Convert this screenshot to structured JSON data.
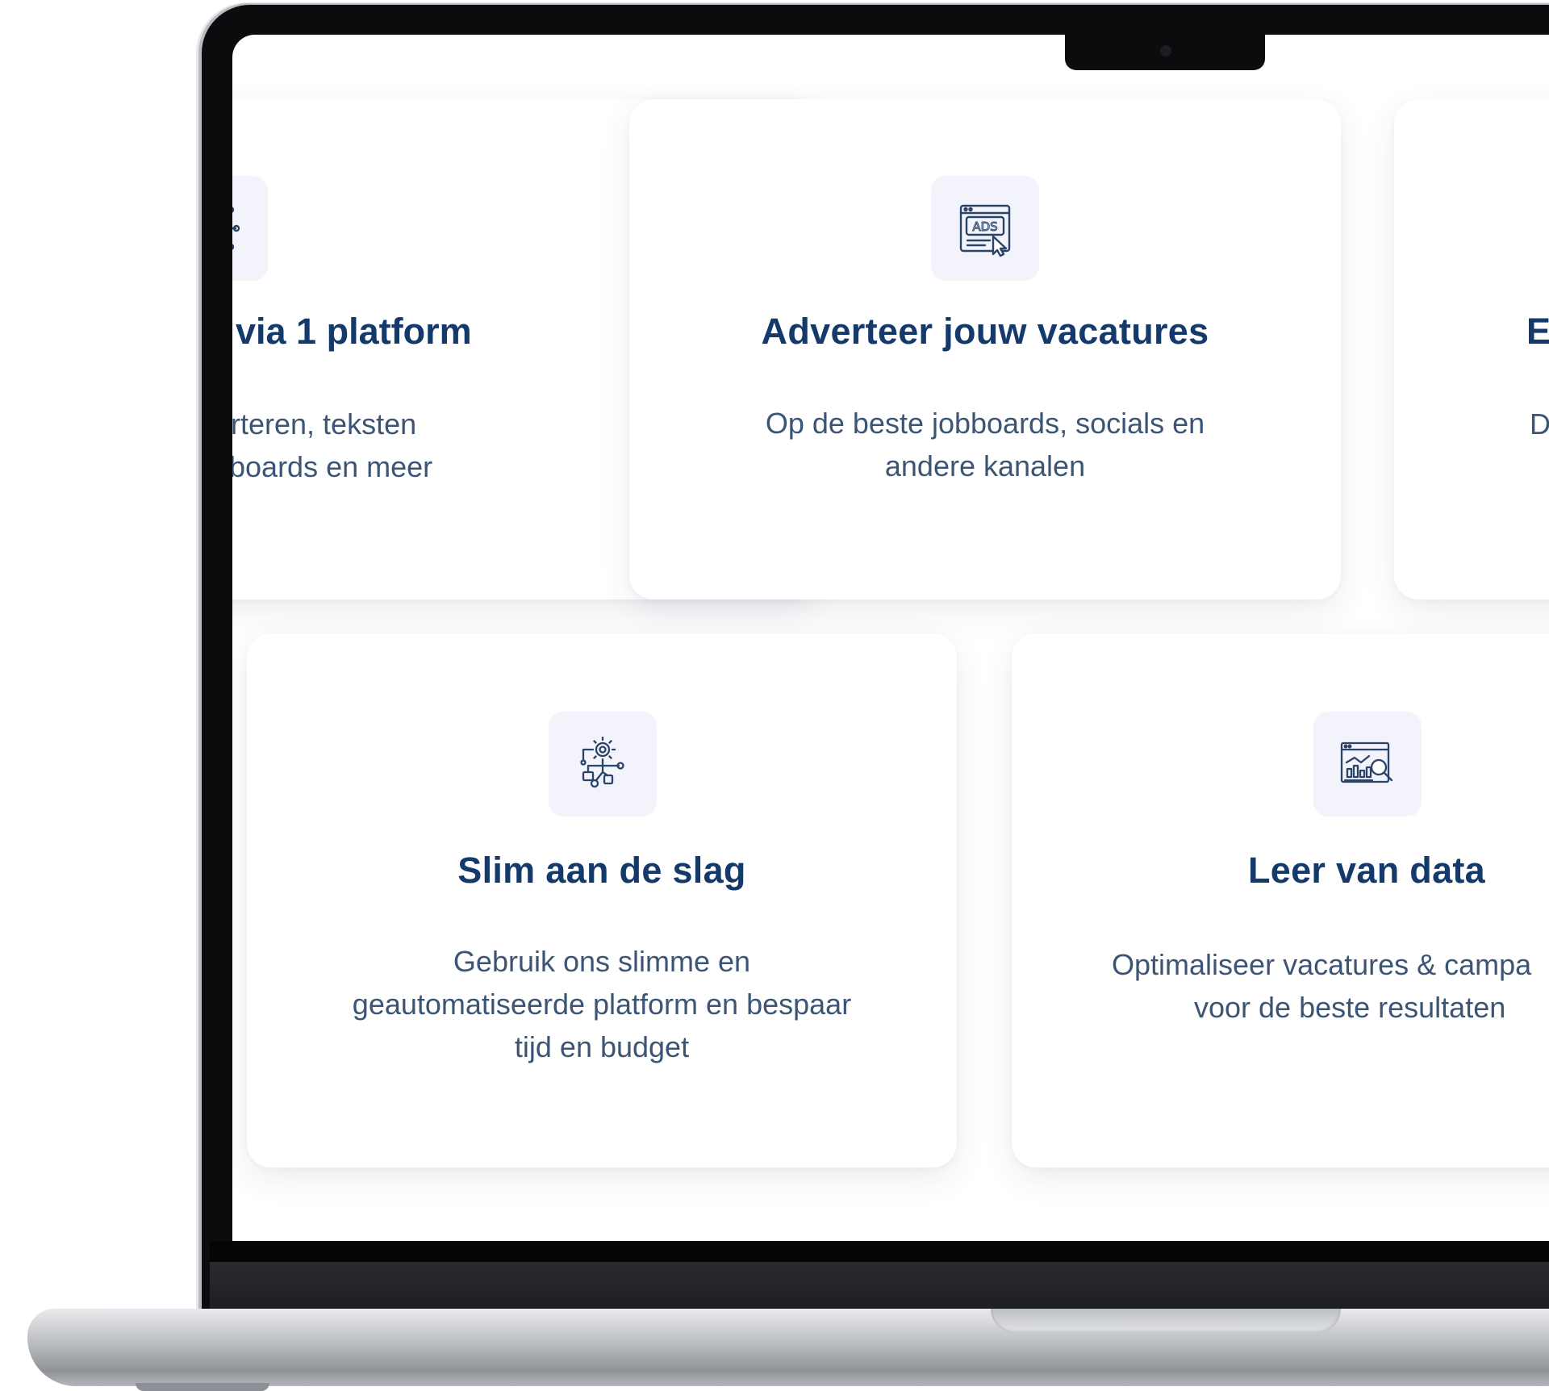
{
  "cards": [
    {
      "title": "via 1 platform",
      "desc_line1": "rteren, teksten",
      "desc_line2": "boards en meer",
      "icon": "network-nodes-icon"
    },
    {
      "title": "Adverteer jouw vacatures",
      "desc_line1": "Op de beste jobboards, socials en",
      "desc_line2": "andere kanalen",
      "icon": "ads-icon"
    },
    {
      "title": "E",
      "desc_line1": "D",
      "icon": ""
    },
    {
      "title": "Slim aan de slag",
      "desc_line1": "Gebruik ons slimme en",
      "desc_line2": "geautomatiseerde platform en bespaar",
      "desc_line3": "tijd en budget",
      "icon": "gear-network-icon"
    },
    {
      "title": "Leer van data",
      "desc_line1": "Optimaliseer vacatures & campa",
      "desc_line2": "voor de beste resultaten",
      "icon": "analytics-search-icon"
    }
  ],
  "colors": {
    "title": "#143a6b",
    "text": "#3d5574",
    "icon_stroke": "#2a4468",
    "icon_tile": "#f3f3fc"
  }
}
